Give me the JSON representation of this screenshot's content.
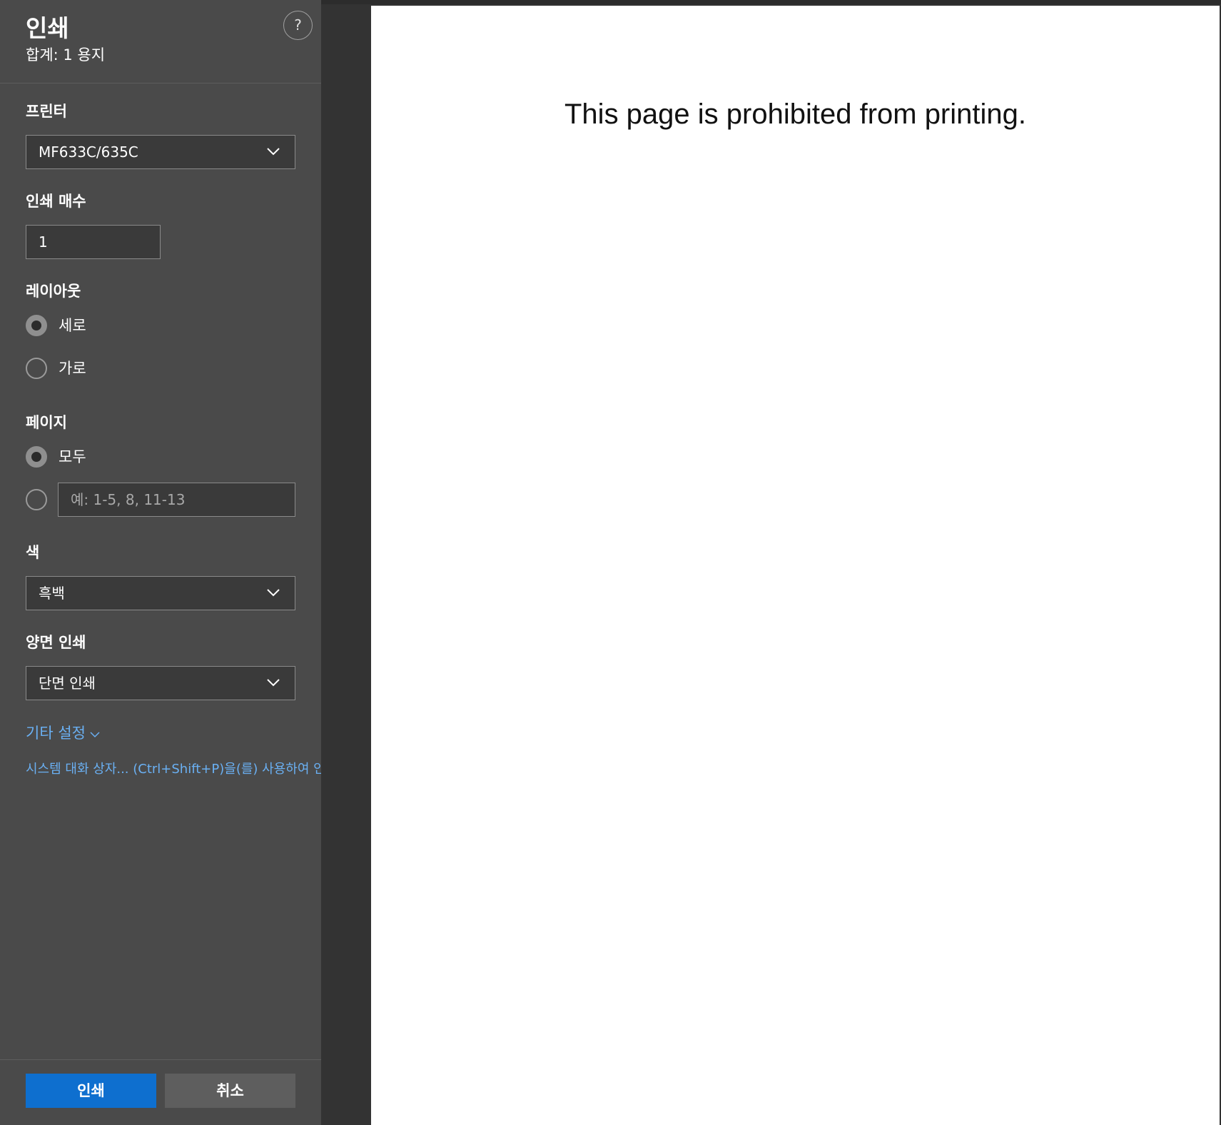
{
  "panel": {
    "title": "인쇄",
    "summary": "합계: 1 용지",
    "help_label": "?"
  },
  "printer": {
    "label": "프린터",
    "selected": "MF633C/635C"
  },
  "copies": {
    "label": "인쇄 매수",
    "value": "1"
  },
  "layout": {
    "label": "레이아웃",
    "options": [
      {
        "label": "세로",
        "checked": true
      },
      {
        "label": "가로",
        "checked": false
      }
    ]
  },
  "pages": {
    "label": "페이지",
    "options": [
      {
        "label": "모두",
        "checked": true
      }
    ],
    "custom_placeholder": "예: 1-5, 8, 11-13"
  },
  "color": {
    "label": "색",
    "selected": "흑백"
  },
  "duplex": {
    "label": "양면 인쇄",
    "selected": "단면 인쇄"
  },
  "more_settings": "기타 설정",
  "system_dialog_link": "시스템 대화 상자... (Ctrl+Shift+P)을(를) 사용하여 인",
  "buttons": {
    "print": "인쇄",
    "cancel": "취소"
  },
  "preview": {
    "message": "This page is prohibited from printing."
  },
  "colors": {
    "accent": "#0e6fcf",
    "link": "#6ab0f3",
    "panel_bg": "#4a4a4a"
  },
  "icons": [
    "help-icon",
    "chevron-down-icon"
  ]
}
